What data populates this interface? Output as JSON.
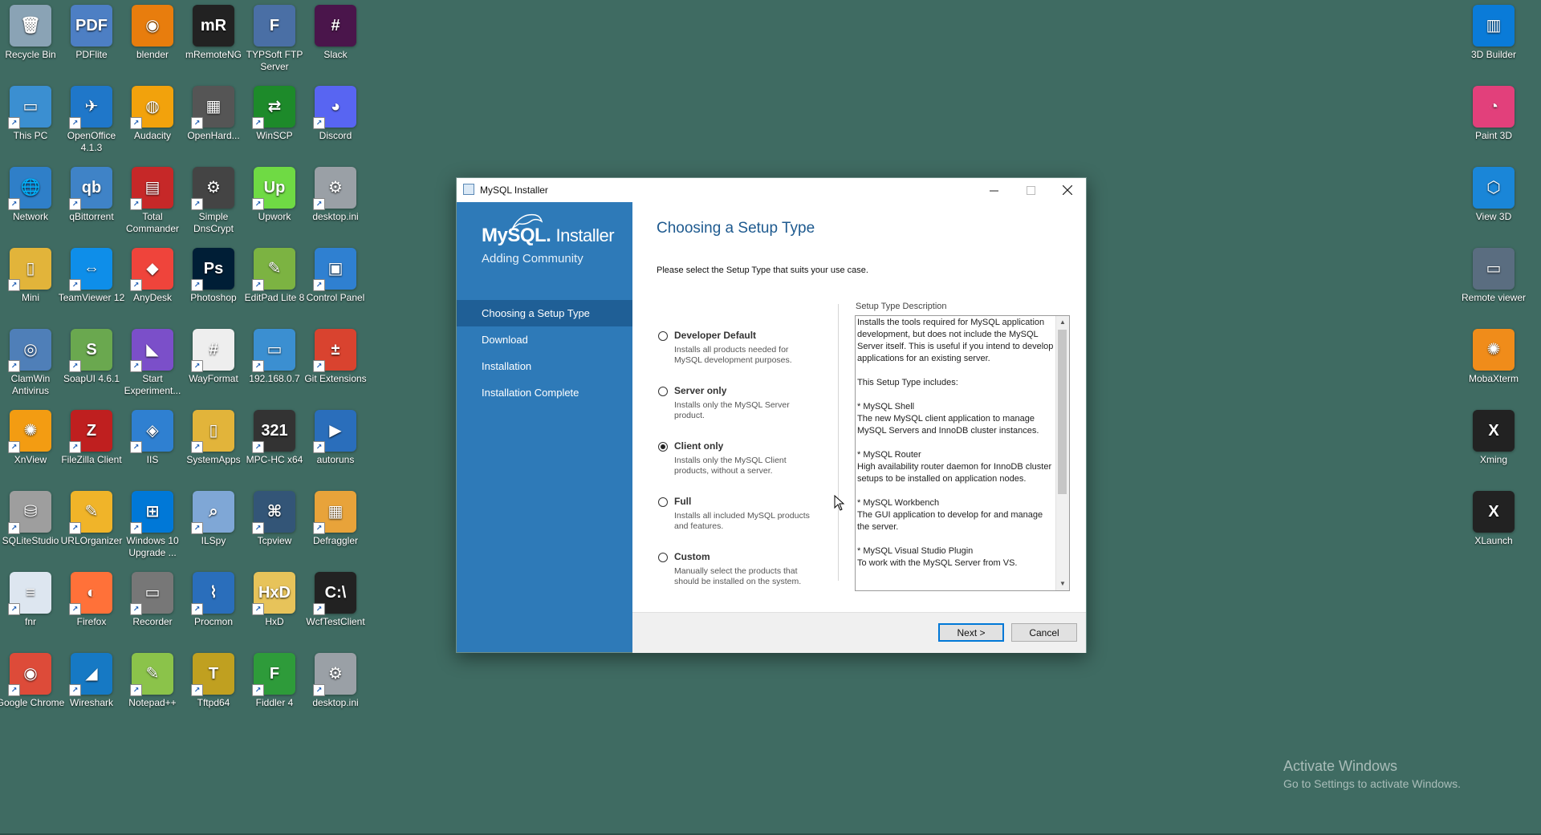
{
  "desktop": {
    "icons": [
      {
        "label": "Recycle Bin",
        "glyph": "🗑",
        "color": "#8aa3b5"
      },
      {
        "label": "PDFlite",
        "glyph": "PDF",
        "color": "#4d7fc4"
      },
      {
        "label": "blender",
        "glyph": "◉",
        "color": "#e87d0d"
      },
      {
        "label": "mRemoteNG",
        "glyph": "mR",
        "color": "#222222"
      },
      {
        "label": "TYPSoft FTP Server",
        "glyph": "F",
        "color": "#4a6fa5"
      },
      {
        "label": "Slack",
        "glyph": "#",
        "color": "#4a154b"
      },
      {
        "label": "This PC",
        "glyph": "▭",
        "color": "#3b8fd1"
      },
      {
        "label": "OpenOffice 4.1.3",
        "glyph": "✈",
        "color": "#1f77c9"
      },
      {
        "label": "Audacity",
        "glyph": "◍",
        "color": "#f2a20c"
      },
      {
        "label": "OpenHard...",
        "glyph": "▦",
        "color": "#555555"
      },
      {
        "label": "WinSCP",
        "glyph": "⇄",
        "color": "#1d8a2a"
      },
      {
        "label": "Discord",
        "glyph": "◕",
        "color": "#5865f2"
      },
      {
        "label": "Network",
        "glyph": "🌐",
        "color": "#2f7fc8"
      },
      {
        "label": "qBittorrent",
        "glyph": "qb",
        "color": "#3f83c7"
      },
      {
        "label": "Total Commander",
        "glyph": "▤",
        "color": "#c62828"
      },
      {
        "label": "Simple DnsCrypt",
        "glyph": "⚙",
        "color": "#444444"
      },
      {
        "label": "Upwork",
        "glyph": "Up",
        "color": "#6fda44"
      },
      {
        "label": "desktop.ini",
        "glyph": "⚙",
        "color": "#9aa0a6"
      },
      {
        "label": "Mini",
        "glyph": "▯",
        "color": "#e2b43a"
      },
      {
        "label": "TeamViewer 12",
        "glyph": "⇔",
        "color": "#0e8ee9"
      },
      {
        "label": "AnyDesk",
        "glyph": "◆",
        "color": "#ef443b"
      },
      {
        "label": "Photoshop",
        "glyph": "Ps",
        "color": "#001e36"
      },
      {
        "label": "EditPad Lite 8",
        "glyph": "✎",
        "color": "#7cb342"
      },
      {
        "label": "Control Panel",
        "glyph": "▣",
        "color": "#2f80d1"
      },
      {
        "label": "ClamWin Antivirus",
        "glyph": "◎",
        "color": "#4f7fb8"
      },
      {
        "label": "SoapUI 4.6.1",
        "glyph": "S",
        "color": "#6aa84f"
      },
      {
        "label": "Start Experiment...",
        "glyph": "◣",
        "color": "#7b4fc9"
      },
      {
        "label": "WayFormat",
        "glyph": "#",
        "color": "#eeeeee"
      },
      {
        "label": "192.168.0.7",
        "glyph": "▭",
        "color": "#3b8fd1"
      },
      {
        "label": "Git Extensions",
        "glyph": "±",
        "color": "#d9432f"
      },
      {
        "label": "XnView",
        "glyph": "✺",
        "color": "#f39c12"
      },
      {
        "label": "FileZilla Client",
        "glyph": "Z",
        "color": "#bf1f1f"
      },
      {
        "label": "IIS",
        "glyph": "◈",
        "color": "#2f80d1"
      },
      {
        "label": "SystemApps",
        "glyph": "▯",
        "color": "#e2b43a"
      },
      {
        "label": "MPC-HC x64",
        "glyph": "321",
        "color": "#333333"
      },
      {
        "label": "autoruns",
        "glyph": "▶",
        "color": "#2a6ebb"
      },
      {
        "label": "SQLiteStudio",
        "glyph": "⛁",
        "color": "#9e9e9e"
      },
      {
        "label": "URLOrganizer",
        "glyph": "✎",
        "color": "#f0b429"
      },
      {
        "label": "Windows 10 Upgrade ...",
        "glyph": "⊞",
        "color": "#0078d7"
      },
      {
        "label": "ILSpy",
        "glyph": "⌕",
        "color": "#7fa7d6"
      },
      {
        "label": "Tcpview",
        "glyph": "⌘",
        "color": "#335577"
      },
      {
        "label": "Defraggler",
        "glyph": "▦",
        "color": "#e8a33a"
      },
      {
        "label": "fnr",
        "glyph": "≡",
        "color": "#dde6f0"
      },
      {
        "label": "Firefox",
        "glyph": "◐",
        "color": "#ff7139"
      },
      {
        "label": "Recorder",
        "glyph": "▭",
        "color": "#777777"
      },
      {
        "label": "Procmon",
        "glyph": "⌇",
        "color": "#2a6ebb"
      },
      {
        "label": "HxD",
        "glyph": "HxD",
        "color": "#e7c35a"
      },
      {
        "label": "WcfTestClient",
        "glyph": "C:\\",
        "color": "#222222"
      },
      {
        "label": "Google Chrome",
        "glyph": "◉",
        "color": "#dd4b39"
      },
      {
        "label": "Wireshark",
        "glyph": "◢",
        "color": "#1679c4"
      },
      {
        "label": "Notepad++",
        "glyph": "✎",
        "color": "#8bc34a"
      },
      {
        "label": "Tftpd64",
        "glyph": "T",
        "color": "#c0a020"
      },
      {
        "label": "Fiddler 4",
        "glyph": "F",
        "color": "#2e9b3a"
      },
      {
        "label": "desktop.ini",
        "glyph": "⚙",
        "color": "#9aa0a6"
      }
    ],
    "right_icons": [
      {
        "label": "3D Builder",
        "glyph": "▥",
        "color": "#0a7bd8"
      },
      {
        "label": "Paint 3D",
        "glyph": "◔",
        "color": "#e2407b"
      },
      {
        "label": "View 3D",
        "glyph": "⬡",
        "color": "#1a86d8"
      },
      {
        "label": "Remote viewer",
        "glyph": "▭",
        "color": "#5a6d80"
      },
      {
        "label": "MobaXterm",
        "glyph": "✺",
        "color": "#f08c1a"
      },
      {
        "label": "Xming",
        "glyph": "X",
        "color": "#222222"
      },
      {
        "label": "XLaunch",
        "glyph": "X",
        "color": "#222222"
      }
    ]
  },
  "window": {
    "title": "MySQL Installer",
    "logo_brand": "MySQL.",
    "logo_product": "Installer",
    "subtitle": "Adding Community",
    "steps": [
      {
        "label": "Choosing a Setup Type",
        "active": true
      },
      {
        "label": "Download",
        "active": false
      },
      {
        "label": "Installation",
        "active": false
      },
      {
        "label": "Installation Complete",
        "active": false
      }
    ],
    "heading": "Choosing a Setup Type",
    "prompt": "Please select the Setup Type that suits your use case.",
    "options": [
      {
        "name": "Developer Default",
        "desc": "Installs all products needed for MySQL development purposes.",
        "selected": false
      },
      {
        "name": "Server only",
        "desc": "Installs only the MySQL Server product.",
        "selected": false
      },
      {
        "name": "Client only",
        "desc": "Installs only the MySQL Client products, without a server.",
        "selected": true
      },
      {
        "name": "Full",
        "desc": "Installs all included MySQL products and features.",
        "selected": false
      },
      {
        "name": "Custom",
        "desc": "Manually select the products that should be installed on the system.",
        "selected": false
      }
    ],
    "description_label": "Setup Type Description",
    "description_text": "Installs the tools required for MySQL application development, but does not include the MySQL Server itself. This is useful if you intend to develop applications for an existing server.\n\nThis Setup Type includes:\n\n* MySQL Shell\nThe new MySQL client application to manage MySQL Servers and InnoDB cluster instances.\n\n* MySQL Router\nHigh availability router daemon for InnoDB cluster setups to be installed on application nodes.\n\n* MySQL Workbench\nThe GUI application to develop for and manage the server.\n\n* MySQL Visual Studio Plugin\nTo work with the MySQL Server from VS.",
    "next_label": "Next >",
    "cancel_label": "Cancel",
    "accent_color": "#2e7ab8"
  },
  "watermark": {
    "line1": "Activate Windows",
    "line2": "Go to Settings to activate Windows."
  }
}
